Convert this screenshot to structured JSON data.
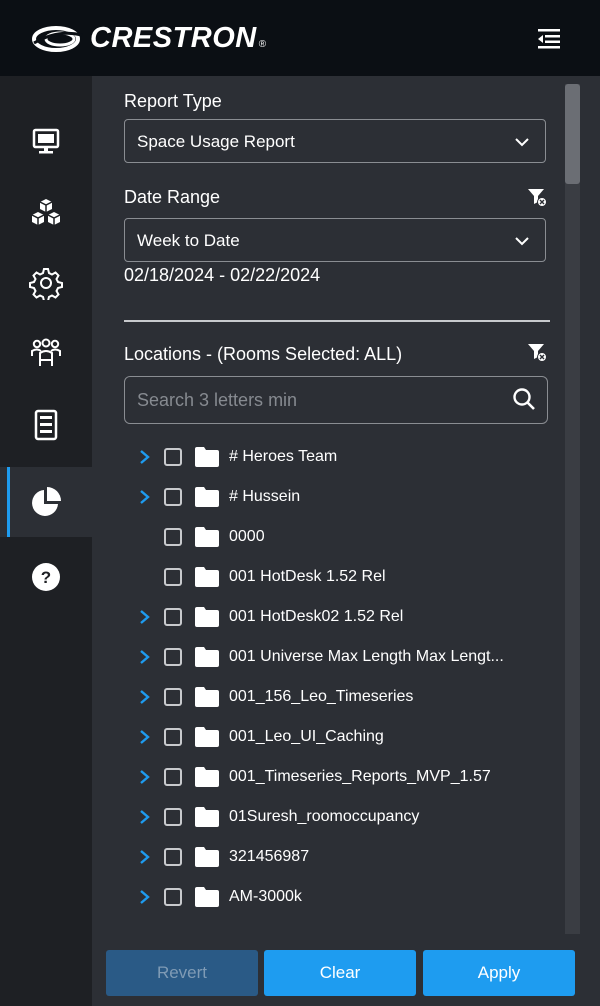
{
  "header": {
    "brand": "CRESTRON",
    "brand_mark": "®"
  },
  "rail": {
    "items": [
      {
        "icon": "monitor-icon"
      },
      {
        "icon": "cubes-icon"
      },
      {
        "icon": "gear-icon"
      },
      {
        "icon": "users-icon"
      },
      {
        "icon": "document-icon"
      },
      {
        "icon": "pie-chart-icon",
        "active": true
      },
      {
        "icon": "help-icon"
      }
    ]
  },
  "report_type": {
    "label": "Report Type",
    "value": "Space Usage Report"
  },
  "date_range": {
    "label": "Date Range",
    "value": "Week to Date",
    "range_text": "02/18/2024 - 02/22/2024"
  },
  "locations": {
    "label": "Locations - (Rooms Selected: ALL)"
  },
  "search": {
    "placeholder": "Search 3 letters min"
  },
  "tree": {
    "items": [
      {
        "name": "# Heroes Team",
        "expandable": true
      },
      {
        "name": "# Hussein",
        "expandable": true
      },
      {
        "name": "0000",
        "expandable": false
      },
      {
        "name": "001 HotDesk 1.52 Rel",
        "expandable": false
      },
      {
        "name": "001 HotDesk02 1.52 Rel",
        "expandable": true
      },
      {
        "name": "001 Universe Max Length Max Lengt...",
        "expandable": true
      },
      {
        "name": "001_156_Leo_Timeseries",
        "expandable": true
      },
      {
        "name": "001_Leo_UI_Caching",
        "expandable": true
      },
      {
        "name": "001_Timeseries_Reports_MVP_1.57",
        "expandable": true
      },
      {
        "name": "01Suresh_roomoccupancy",
        "expandable": true
      },
      {
        "name": "321456987",
        "expandable": true
      },
      {
        "name": "AM-3000k",
        "expandable": true
      }
    ]
  },
  "footer": {
    "revert_label": "Revert",
    "clear_label": "Clear",
    "apply_label": "Apply"
  },
  "colors": {
    "accent": "#1e9cf0",
    "panel": "#2c2f35",
    "rail": "#1e2024",
    "header": "#0b0f14"
  }
}
